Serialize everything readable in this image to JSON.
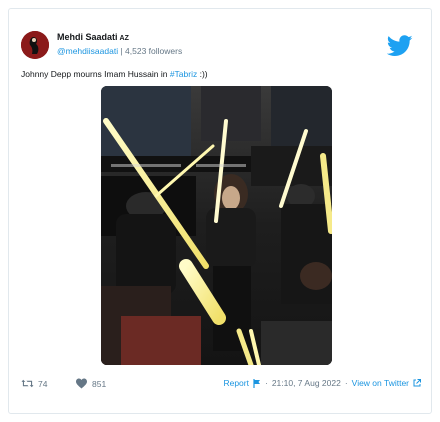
{
  "author": {
    "name": "Mehdi Saadati",
    "name_suffix": "AZ",
    "handle": "@mehdiisaadati",
    "followers": "4,523 followers"
  },
  "tweet": {
    "text_prefix": "Johnny Depp mourns Imam Hussain in ",
    "hashtag": "#Tabriz",
    "text_suffix": " :))"
  },
  "footer": {
    "retweets": "74",
    "likes": "851",
    "report_label": "Report",
    "timestamp": "21:10, 7 Aug 2022",
    "view_link": "View on Twitter"
  },
  "colors": {
    "accent": "#1b95e0",
    "bird": "#1da1f2",
    "muted": "#657786"
  }
}
